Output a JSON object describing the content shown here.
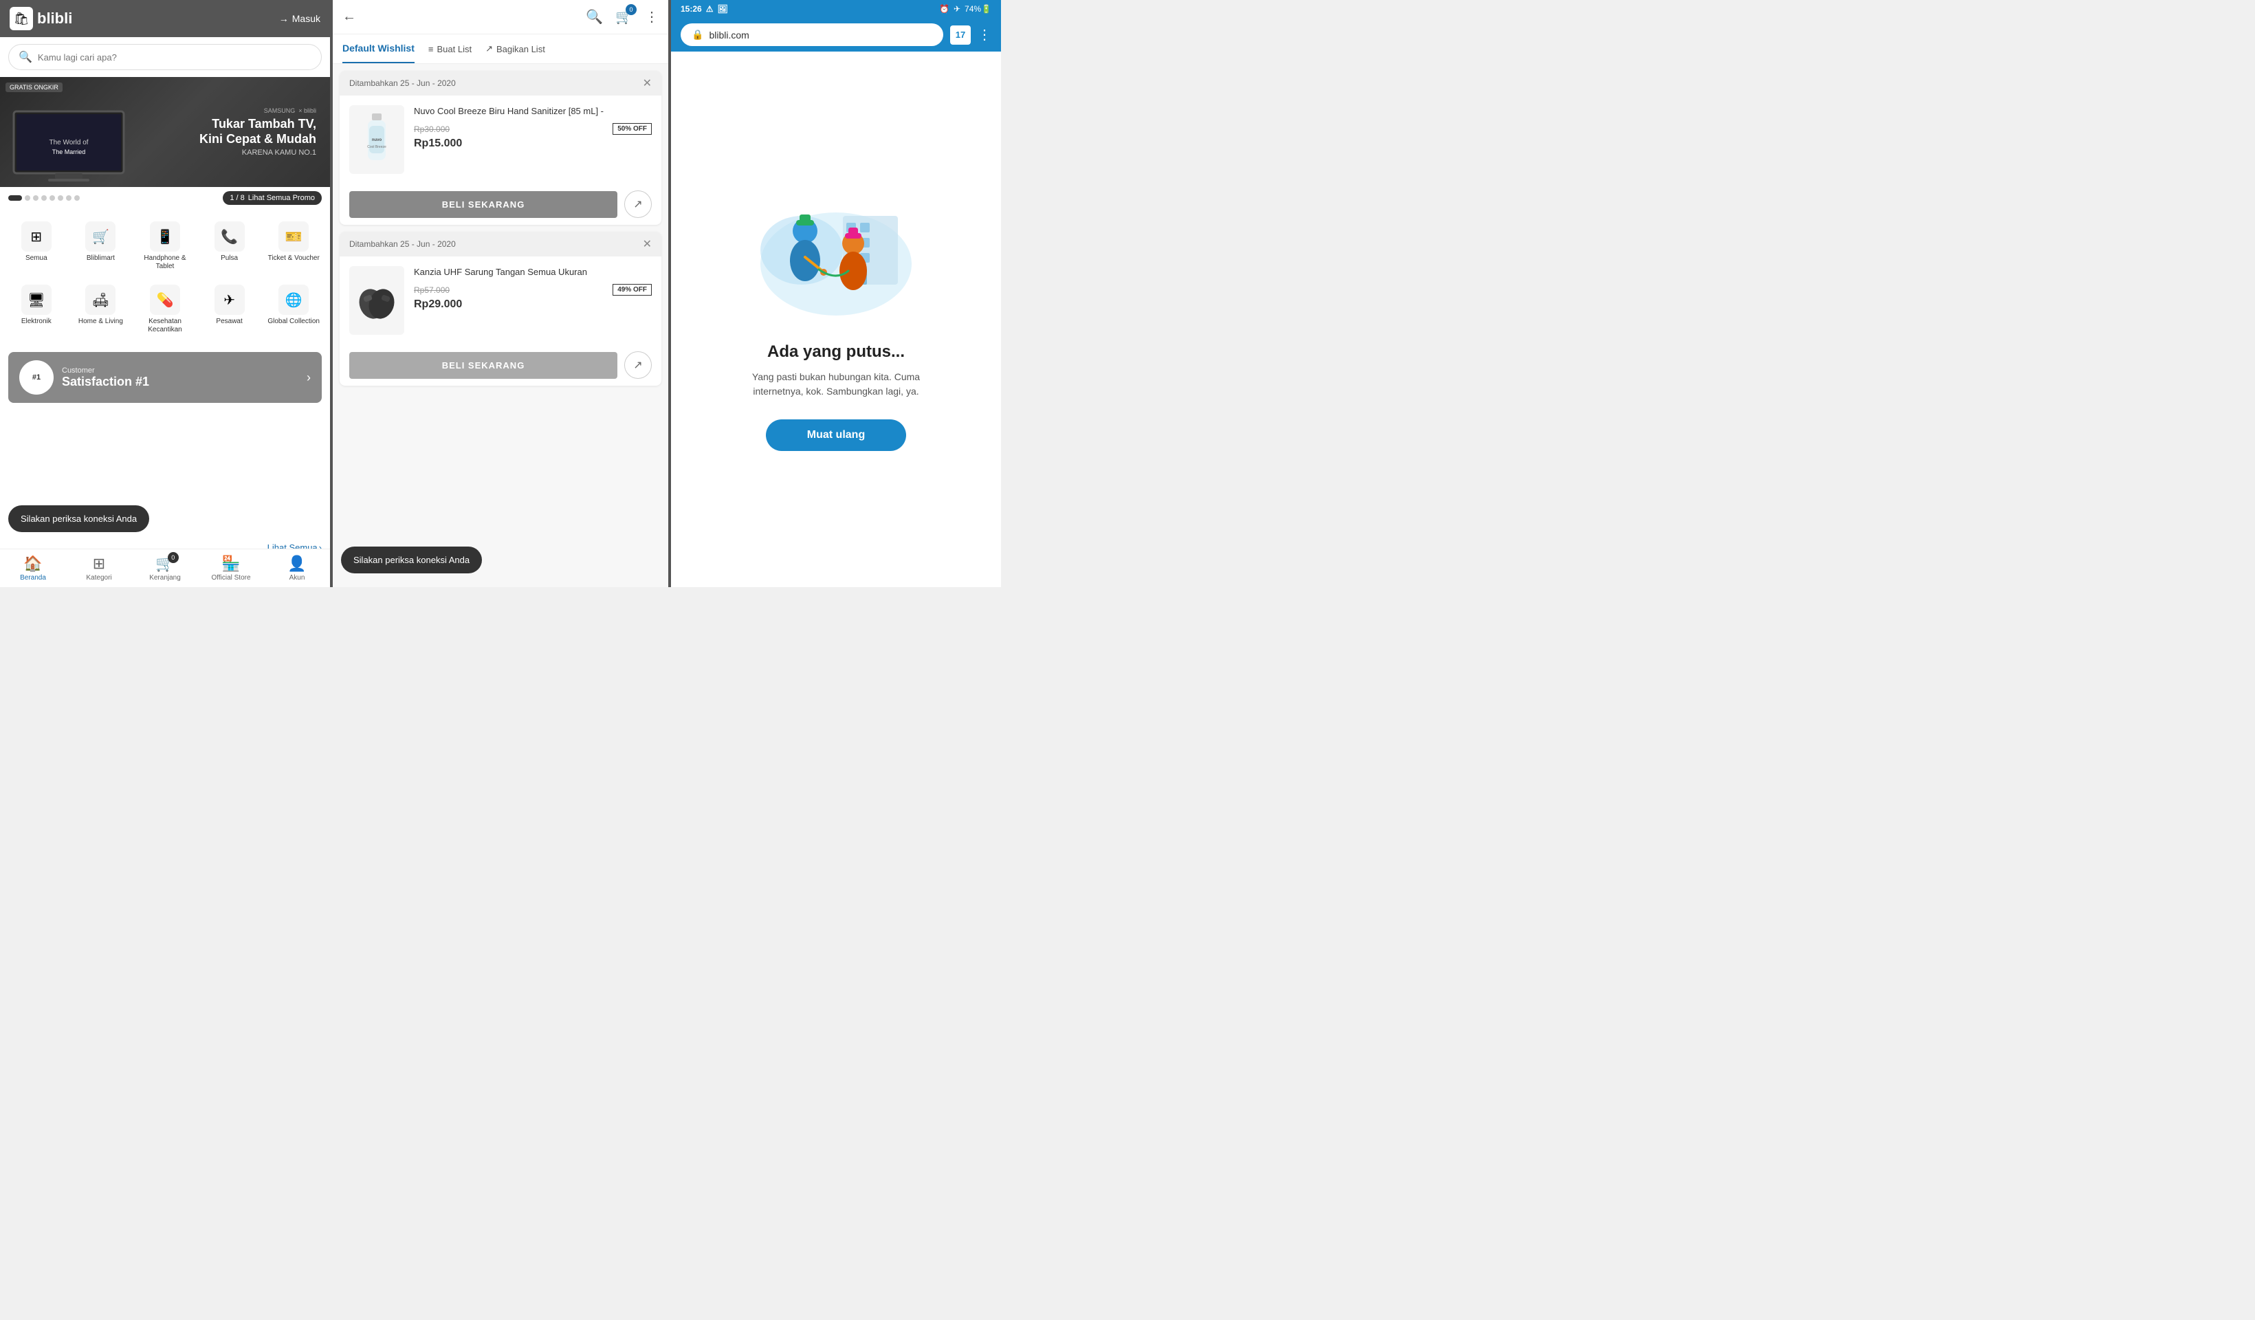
{
  "panel1": {
    "header": {
      "logo_text": "blibli",
      "logo_icon": "🛍",
      "login_label": "Masuk"
    },
    "search": {
      "placeholder": "Kamu lagi cari apa?"
    },
    "banner": {
      "badge": "GRATIS ONGKIR",
      "brand": "SAMSUNG",
      "title": "Tukar Tambah TV,",
      "subtitle": "Kini Cepat & Mudah",
      "tagline": "KARENA KAMU NO.1",
      "counter": "1 / 8",
      "promo_label": "Lihat Semua Promo"
    },
    "dots": [
      true,
      false,
      false,
      false,
      false,
      false,
      false,
      false
    ],
    "categories": [
      {
        "icon": "⊞",
        "label": "Semua"
      },
      {
        "icon": "🛒",
        "label": "Bliblimart"
      },
      {
        "icon": "📱",
        "label": "Handphone & Tablet"
      },
      {
        "icon": "📞",
        "label": "Pulsa"
      },
      {
        "icon": "🎫",
        "label": "Ticket & Voucher"
      },
      {
        "icon": "🖥",
        "label": "Elektronik"
      },
      {
        "icon": "🛋",
        "label": "Home & Living"
      },
      {
        "icon": "💊",
        "label": "Kesehatan Kecantikan"
      },
      {
        "icon": "✈",
        "label": "Pesawat"
      },
      {
        "icon": "🌐",
        "label": "Global Collection"
      }
    ],
    "satisfaction": {
      "icon": "#1",
      "label": "Customer",
      "title": "Satisfaction #1"
    },
    "toast": "Silakan periksa koneksi Anda",
    "lihat_semua": "Lihat Semua",
    "bottom_nav": [
      {
        "icon": "🏠",
        "label": "Beranda",
        "active": true
      },
      {
        "icon": "⊞",
        "label": "Kategori",
        "active": false
      },
      {
        "icon": "🛒",
        "label": "Keranjang",
        "active": false,
        "badge": "0"
      },
      {
        "icon": "🏪",
        "label": "Official Store",
        "active": false
      },
      {
        "icon": "👤",
        "label": "Akun",
        "active": false
      }
    ]
  },
  "panel2": {
    "header": {
      "back_icon": "←",
      "wishlist_action_search": "🔍",
      "wishlist_action_cart": "🛒",
      "cart_badge": "0",
      "wishlist_action_more": "⋮"
    },
    "tabs": {
      "active": "Default Wishlist",
      "items": [
        "Default Wishlist"
      ],
      "actions": [
        {
          "icon": "≡",
          "label": "Buat List"
        },
        {
          "icon": "↗",
          "label": "Bagikan List"
        }
      ]
    },
    "wishlist_items": [
      {
        "date_added": "Ditambahkan 25 - Jun - 2020",
        "product_name": "Nuvo Cool Breeze Biru Hand Sanitizer [85 mL] -",
        "original_price": "Rp30.000",
        "sale_price": "Rp15.000",
        "discount": "50% OFF",
        "action_label": "BELI SEKARANG",
        "type": "bottle"
      },
      {
        "date_added": "Ditambahkan 25 - Jun - 2020",
        "product_name": "Kanzia UHF Sarung Tangan Semua Ukuran",
        "original_price": "Rp57.000",
        "sale_price": "Rp29.000",
        "discount": "49% OFF",
        "action_label": "BELI SEKARANG",
        "type": "gloves"
      }
    ],
    "toast": "Silakan periksa koneksi Anda"
  },
  "panel3": {
    "status_bar": {
      "time": "15:26",
      "battery": "74%",
      "tabs": "17"
    },
    "browser": {
      "url": "blibli.com",
      "lock_icon": "🔒",
      "tab_count": "17",
      "menu_icon": "⋮"
    },
    "error": {
      "title": "Ada yang putus...",
      "description": "Yang pasti bukan hubungan kita. Cuma internetnya, kok. Sambungkan lagi, ya.",
      "button_label": "Muat ulang"
    }
  }
}
